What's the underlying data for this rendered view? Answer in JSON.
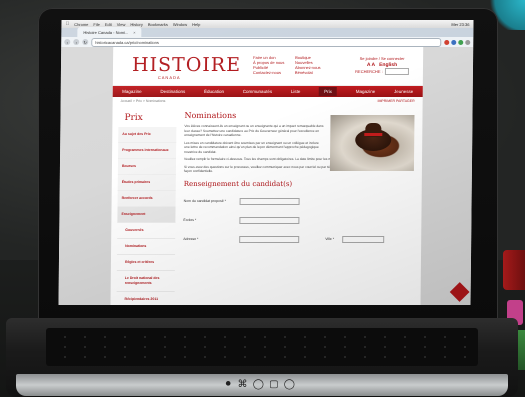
{
  "browser": {
    "menubar": [
      "Chrome",
      "File",
      "Edit",
      "View",
      "History",
      "Bookmarks",
      "Window",
      "Help"
    ],
    "menubar_right": "Mer 23:36",
    "tab_label": "Histoire Canada - Nomi...",
    "url": "historicacanada.ca/prix/nominations"
  },
  "site": {
    "logo": "HISTOIRE",
    "logo_sub": "CANADA",
    "header_links_a": [
      "Faire un don",
      "À propos de nous",
      "Publicité",
      "Contactez-nous"
    ],
    "header_links_b": [
      "Boutique",
      "Nouvelles",
      "Abonnez-vous",
      "Bénévolat"
    ],
    "header_right": {
      "sign_in": "Se joindre / Se connecter",
      "lang_a": "A A",
      "lang_b": "English",
      "search_label": "RECHERCHE :"
    },
    "nav": [
      "Magazine",
      "Destinations",
      "Éducation",
      "Communautés",
      "Liste",
      "Prix",
      "Magazine",
      "Jeunesse"
    ],
    "nav_active_index": 5,
    "breadcrumb": "Accueil > Prix > Nominations",
    "tools": "IMPRIMER  PARTAGER",
    "sidebar": {
      "title": "Prix",
      "items": [
        {
          "label": "Au sujet des Prix",
          "sub": false,
          "hl": false
        },
        {
          "label": "Programmes internationaux",
          "sub": false,
          "hl": false
        },
        {
          "label": "Bourses",
          "sub": false,
          "hl": false
        },
        {
          "label": "Études primaires",
          "sub": false,
          "hl": false
        },
        {
          "label": "Renforcer accords",
          "sub": false,
          "hl": false
        },
        {
          "label": "Enseignement",
          "sub": false,
          "hl": true
        },
        {
          "label": "Gouvernés",
          "sub": true,
          "hl": false
        },
        {
          "label": "Nominations",
          "sub": true,
          "hl": false
        },
        {
          "label": "Règles et critères",
          "sub": true,
          "hl": false
        },
        {
          "label": "Le Droit national des renseignements",
          "sub": true,
          "hl": false
        },
        {
          "label": "Récipiendaires 2011",
          "sub": true,
          "hl": false
        },
        {
          "label": "Prestations 2012",
          "sub": true,
          "hl": false
        }
      ]
    },
    "content": {
      "title": "Nominations",
      "paragraphs": [
        "Vos élèves connaissent-ils un enseignant ou un enseignante qui a un impact remarquable dans leur classe? Soumettez une candidature au Prix du Gouverneur général pour l'excellence en enseignement de l'histoire canadienne.",
        "Les mises en candidature doivent être soumises par un enseignant ou un collègue et inclure une lettre de recommandation ainsi qu'un plan de leçon démontrant l'approche pédagogique novatrice du candidat.",
        "Veuillez remplir le formulaire ci-dessous. Tous les champs sont obligatoires. La date limite pour les mises en candidature est annoncée sur le site des Prix.",
        "Si vous avez des questions sur le processus, veuillez communiquer avec nous par courriel ou par téléphone. Les renseignements fournis seront traités de façon confidentielle."
      ],
      "candidate_title": "Renseignement du candidat(s)",
      "form": {
        "first_name_label": "Nom du candidat proposé *",
        "email_label": "Écoles *",
        "address_label": "Adresse *",
        "city_label": "Ville *"
      }
    }
  },
  "colors": {
    "brand_red": "#b0161a"
  }
}
